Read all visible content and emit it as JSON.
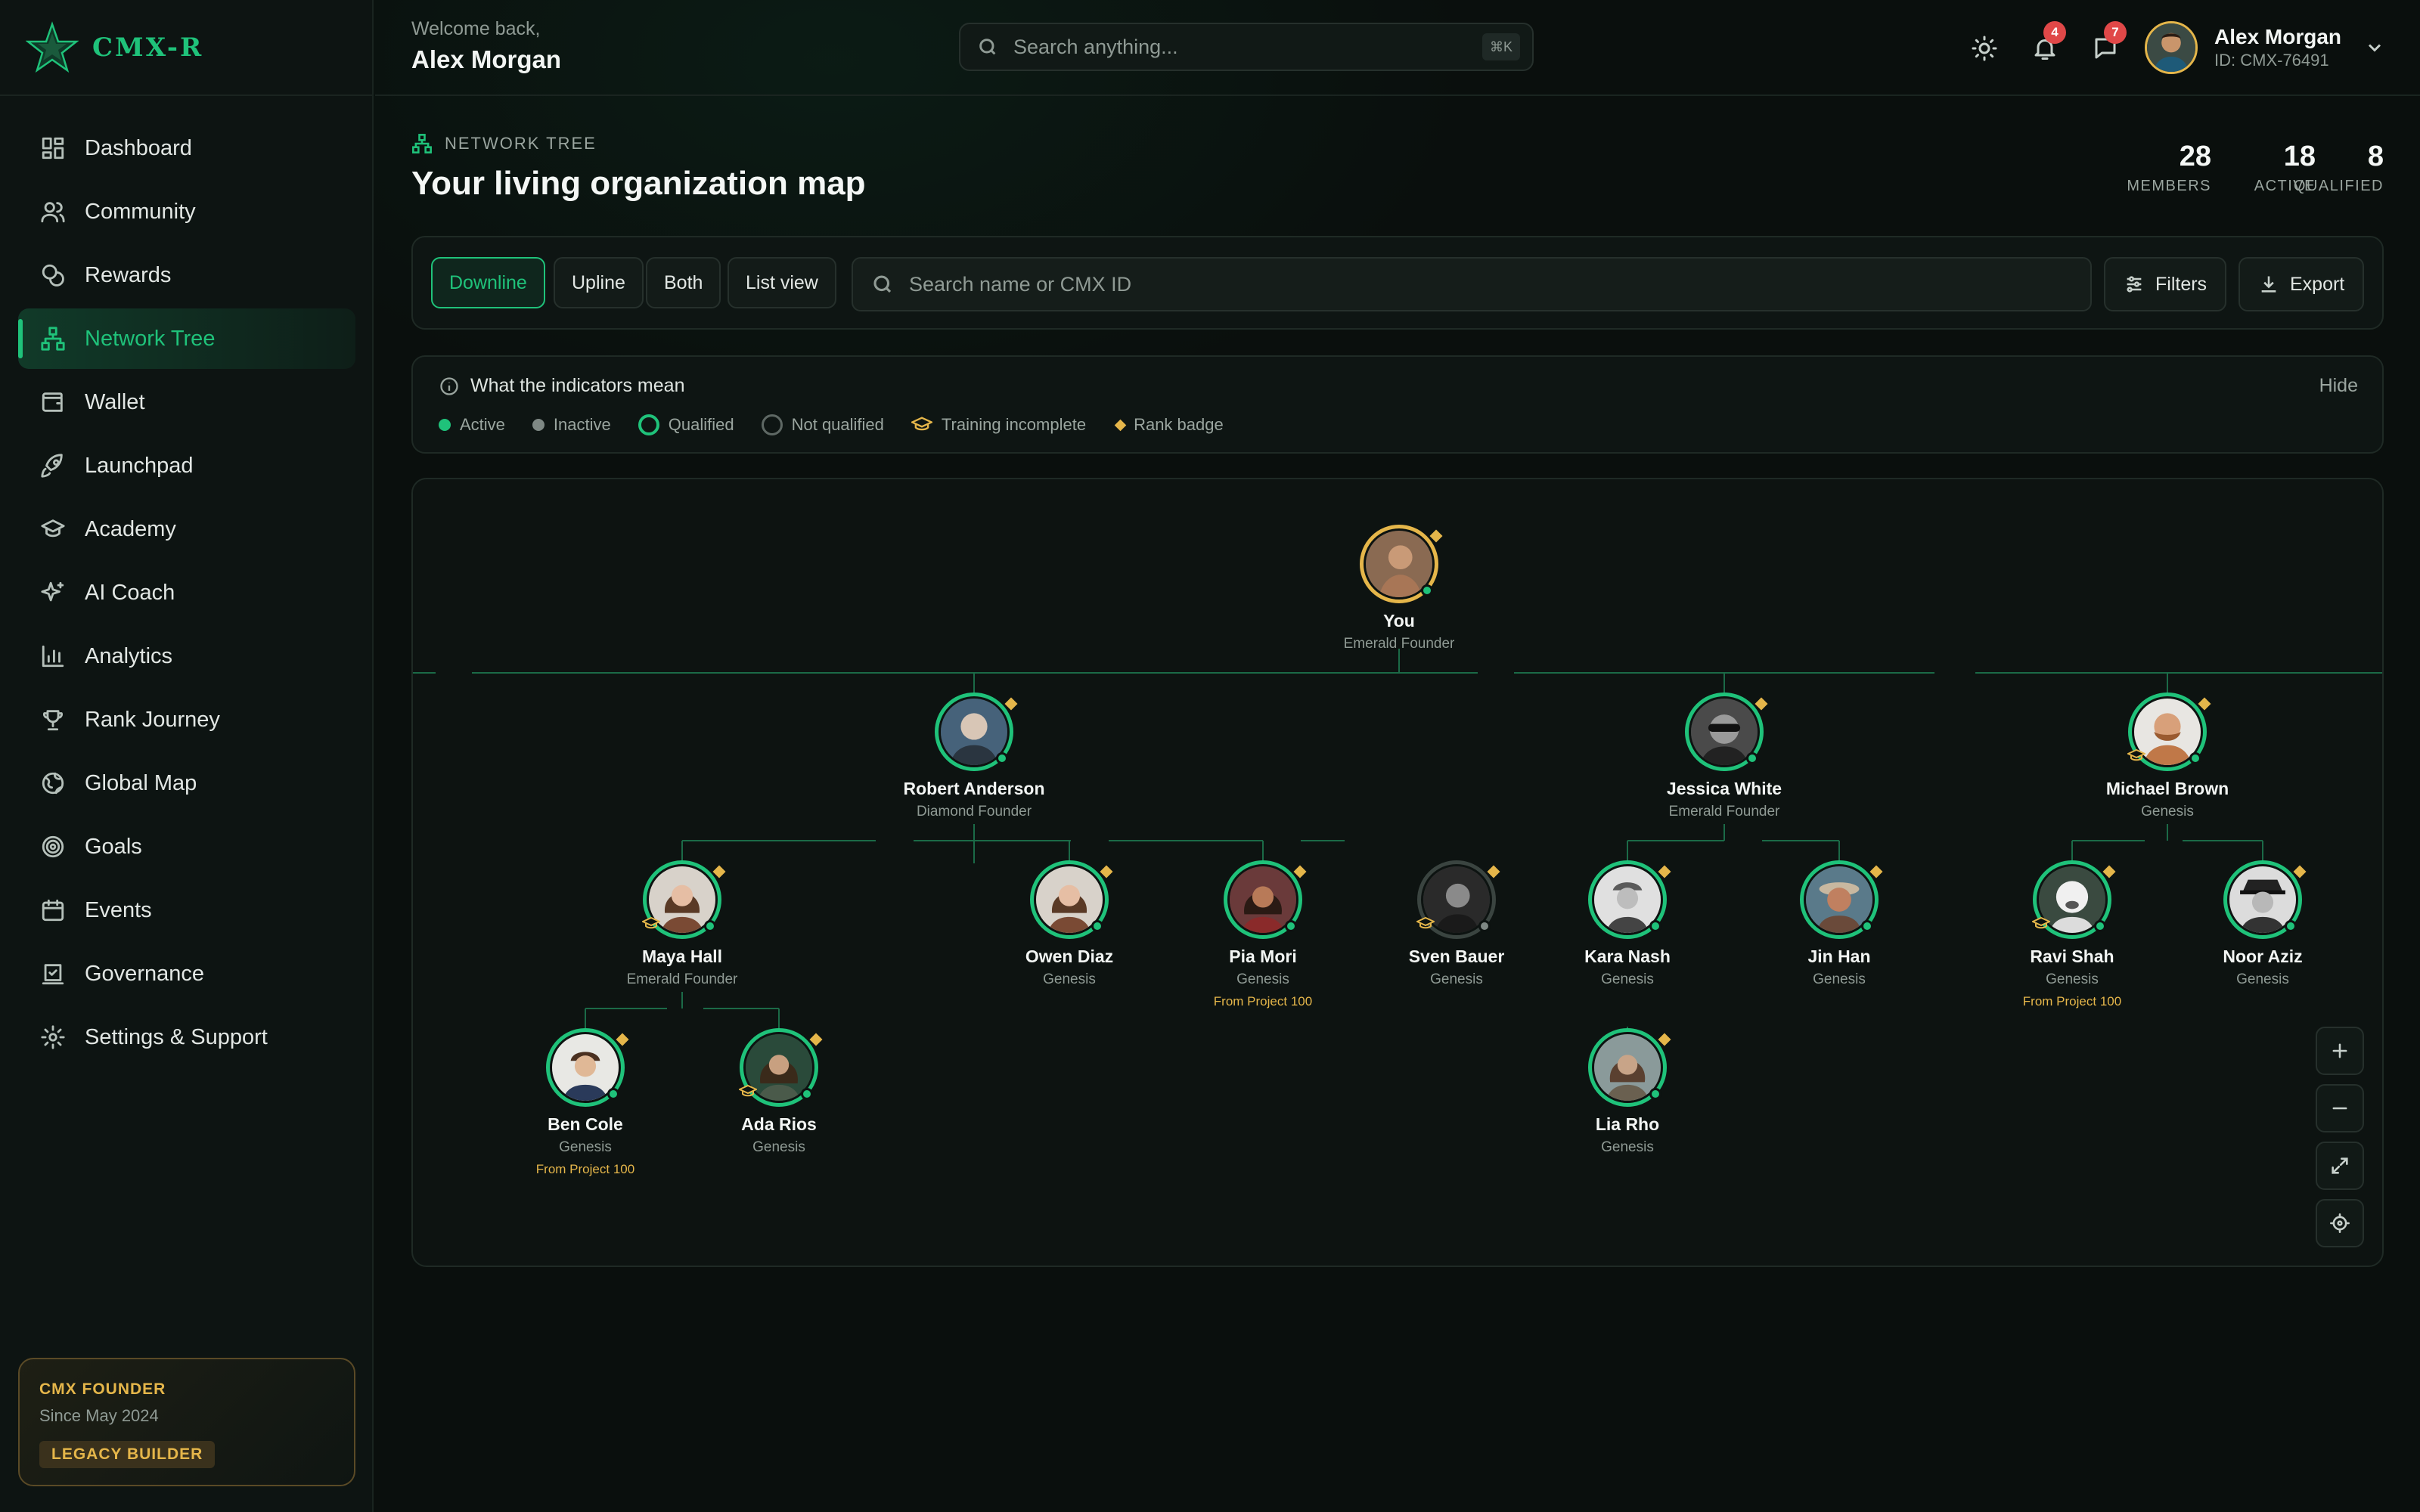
{
  "brand": {
    "name": "CMX-R",
    "accent": "#1fc27a",
    "gold": "#e5b64a"
  },
  "sidebar": {
    "items": [
      {
        "label": "Dashboard",
        "icon": "dashboard-icon"
      },
      {
        "label": "Community",
        "icon": "users-icon"
      },
      {
        "label": "Rewards",
        "icon": "coins-icon"
      },
      {
        "label": "Network Tree",
        "icon": "network-icon"
      },
      {
        "label": "Wallet",
        "icon": "wallet-icon"
      },
      {
        "label": "Launchpad",
        "icon": "rocket-icon"
      },
      {
        "label": "Academy",
        "icon": "graduation-cap-icon"
      },
      {
        "label": "AI Coach",
        "icon": "sparkles-icon"
      },
      {
        "label": "Analytics",
        "icon": "bar-chart-icon"
      },
      {
        "label": "Rank Journey",
        "icon": "trophy-icon"
      },
      {
        "label": "Global Map",
        "icon": "globe-icon"
      },
      {
        "label": "Goals",
        "icon": "target-icon"
      },
      {
        "label": "Events",
        "icon": "calendar-icon"
      },
      {
        "label": "Governance",
        "icon": "vote-icon"
      },
      {
        "label": "Settings & Support",
        "icon": "gear-icon"
      }
    ],
    "founder": {
      "title": "CMX FOUNDER",
      "since": "Since May 2024",
      "badge": "LEGACY BUILDER"
    }
  },
  "header": {
    "welcome": "Welcome back,",
    "username": "Alex Morgan",
    "search_placeholder": "Search anything...",
    "search_shortcut": "⌘K",
    "notifications_count": "4",
    "messages_count": "7",
    "profile_name": "Alex Morgan",
    "profile_id": "ID: CMX-76491"
  },
  "page": {
    "crumb": "NETWORK TREE",
    "title": "Your living organization map",
    "stats": [
      {
        "value": "28",
        "label": "MEMBERS"
      },
      {
        "value": "18",
        "label": "ACTIVE"
      },
      {
        "value": "8",
        "label": "QUALIFIED"
      }
    ]
  },
  "toolbar": {
    "views": [
      "Downline",
      "Upline",
      "Both",
      "List view"
    ],
    "active_view": "Downline",
    "search_placeholder": "Search name or CMX ID",
    "filters_label": "Filters",
    "export_label": "Export"
  },
  "legend": {
    "title": "What the indicators mean",
    "hide_label": "Hide",
    "items": [
      "Active",
      "Inactive",
      "Qualified",
      "Not qualified",
      "Training incomplete",
      "Rank badge"
    ]
  },
  "tree": {
    "root": {
      "name": "You",
      "title": "Emerald Founder"
    },
    "level1": [
      {
        "name": "Robert Anderson",
        "title": "Diamond Founder"
      },
      {
        "name": "Jessica White",
        "title": "Emerald Founder"
      },
      {
        "name": "Michael Brown",
        "title": "Genesis"
      }
    ],
    "level2": [
      {
        "name": "Maya Hall",
        "title": "Emerald Founder",
        "note": ""
      },
      {
        "name": "Owen Diaz",
        "title": "Genesis",
        "note": ""
      },
      {
        "name": "Pia Mori",
        "title": "Genesis",
        "note": "From Project 100"
      },
      {
        "name": "Sven Bauer",
        "title": "Genesis",
        "note": ""
      },
      {
        "name": "Kara Nash",
        "title": "Genesis",
        "note": ""
      },
      {
        "name": "Jin Han",
        "title": "Genesis",
        "note": ""
      },
      {
        "name": "Ravi Shah",
        "title": "Genesis",
        "note": "From Project 100"
      },
      {
        "name": "Noor Aziz",
        "title": "Genesis",
        "note": ""
      }
    ],
    "level3": [
      {
        "name": "Ben Cole",
        "title": "Genesis",
        "note": "From Project 100"
      },
      {
        "name": "Ada Rios",
        "title": "Genesis",
        "note": ""
      },
      {
        "name": "Lia Rho",
        "title": "Genesis",
        "note": ""
      }
    ]
  }
}
